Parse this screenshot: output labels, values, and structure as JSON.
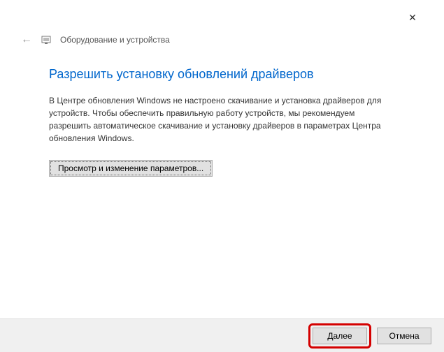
{
  "titlebar": {
    "close_icon": "✕"
  },
  "header": {
    "back_icon": "←",
    "title": "Оборудование и устройства"
  },
  "main": {
    "heading": "Разрешить установку обновлений драйверов",
    "body": "В Центре обновления Windows не настроено скачивание и установка драйверов для устройств. Чтобы обеспечить правильную работу устройств, мы рекомендуем разрешить автоматическое скачивание и установку драйверов в параметрах Центра обновления Windows.",
    "settings_button": "Просмотр и изменение параметров..."
  },
  "footer": {
    "next": "Далее",
    "cancel": "Отмена"
  }
}
